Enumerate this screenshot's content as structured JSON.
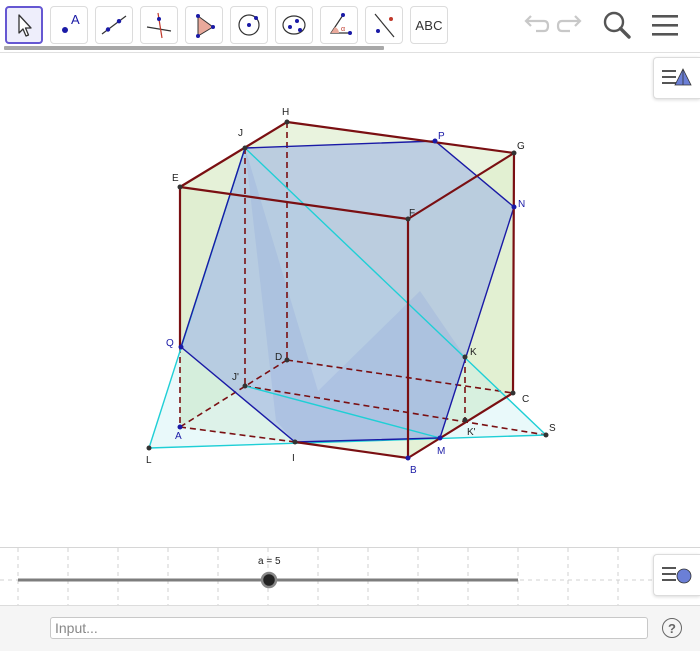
{
  "toolbar": {
    "tools": [
      {
        "name": "move-tool-icon",
        "active": true
      },
      {
        "name": "point-tool-icon"
      },
      {
        "name": "line-tool-icon"
      },
      {
        "name": "perpendicular-line-tool-icon"
      },
      {
        "name": "polygon-tool-icon"
      },
      {
        "name": "circle-center-point-tool-icon"
      },
      {
        "name": "ellipse-tool-icon"
      },
      {
        "name": "angle-tool-icon"
      },
      {
        "name": "reflect-tool-icon"
      },
      {
        "name": "text-tool-icon",
        "label": "ABC"
      }
    ],
    "undo_icon": "undo-icon",
    "redo_icon": "redo-icon",
    "search_icon": "search-icon",
    "menu_icon": "hamburger-menu-icon"
  },
  "graphics": {
    "points": {
      "H": "H",
      "J": "J",
      "P": "P",
      "G": "G",
      "E": "E",
      "F": "F",
      "N": "N",
      "Q": "Q",
      "D": "D",
      "K": "K",
      "Jp": "J'",
      "C": "C",
      "A": "A",
      "Kp": "K'",
      "S": "S",
      "L": "L",
      "I": "I",
      "M": "M",
      "B": "B"
    }
  },
  "slider": {
    "label": "a = 5",
    "value": 5
  },
  "input": {
    "placeholder": "Input..."
  },
  "help": {
    "label": "?"
  },
  "colors": {
    "cube_edge": "#7a0f12",
    "cyan": "#1fcfd6",
    "blue": "#1a1aa6",
    "face_fill": "#dfeecf",
    "section_fill": "#b7c7e6",
    "active_tool": "#6557d2"
  }
}
